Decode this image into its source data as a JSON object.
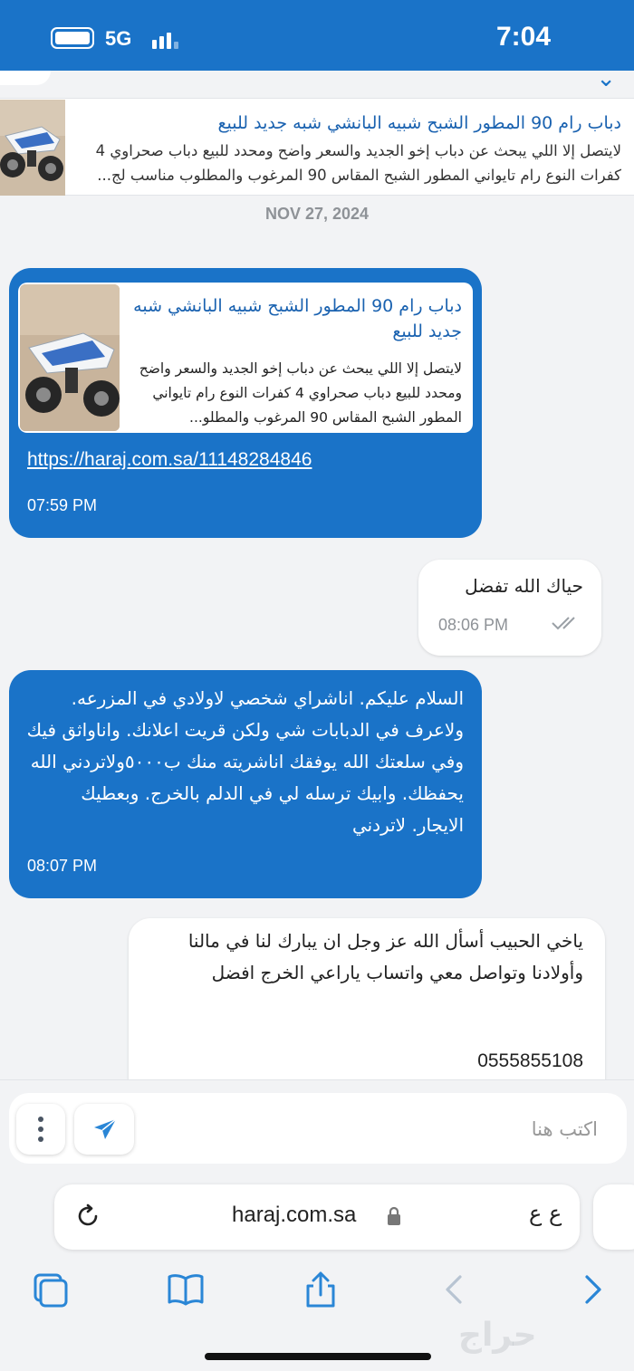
{
  "status_bar": {
    "network": "5G",
    "time": "7:04"
  },
  "listing_banner": {
    "title": "دباب رام 90 المطور الشبح شبيه البانشي شبه جديد للبيع",
    "description": "لايتصل إلا اللي يبحث عن دباب إخو الجديد والسعر واضح ومحدد للبيع دباب صحراوي 4 كفرات النوع رام تايواني المطور الشبح المقاس 90 المرغوب والمطلوب مناسب لج..."
  },
  "date_separator": "NOV 27, 2024",
  "messages": [
    {
      "id": "m1",
      "card_title": "دباب رام 90 المطور الشبح شبيه البانشي شبه جديد للبيع",
      "card_description": "لايتصل إلا اللي يبحث عن دباب إخو الجديد والسعر واضح ومحدد للبيع دباب صحراوي 4 كفرات النوع رام تايواني المطور الشبح المقاس 90 المرغوب والمطلو...",
      "link": "https://haraj.com.sa/11148284846",
      "time": "07:59 PM"
    },
    {
      "id": "m2",
      "text": "حياك الله تفضل",
      "time": "08:06 PM"
    },
    {
      "id": "m3",
      "text": "السلام عليكم. اناشراي شخصي لاولادي في المزرعه. ولاعرف في الدبابات شي ولكن قريت اعلانك. واناواثق فيك وفي سلعتك الله يوفقك اناشريته منك ب٥٠٠٠ولاتردني الله يحفظك. وابيك ترسله لي في الدلم بالخرج. وبعطيك الايجار. لاتردني",
      "time": "08:07 PM"
    },
    {
      "id": "m4",
      "text": "ياخي الحبيب أسأل الله عز وجل ان يبارك لنا في مالنا وأولادنا وتواصل معي واتساب ياراعي الخرج افضل",
      "phone": "0555855108"
    }
  ],
  "composer": {
    "placeholder": "اكتب هنا"
  },
  "browser": {
    "url": "haraj.com.sa",
    "text_size_label": "ع ع"
  },
  "watermark": "حراج",
  "icons": [
    "battery-icon",
    "signal-icon",
    "chevron-icon",
    "more-dots-icon",
    "send-icon",
    "reload-icon",
    "lock-icon",
    "tabs-icon",
    "bookmarks-icon",
    "share-icon",
    "back-icon",
    "forward-icon"
  ],
  "colors": {
    "accent": "#1a73c8",
    "link_text": "#1a62b0",
    "background": "#f2f3f5"
  }
}
